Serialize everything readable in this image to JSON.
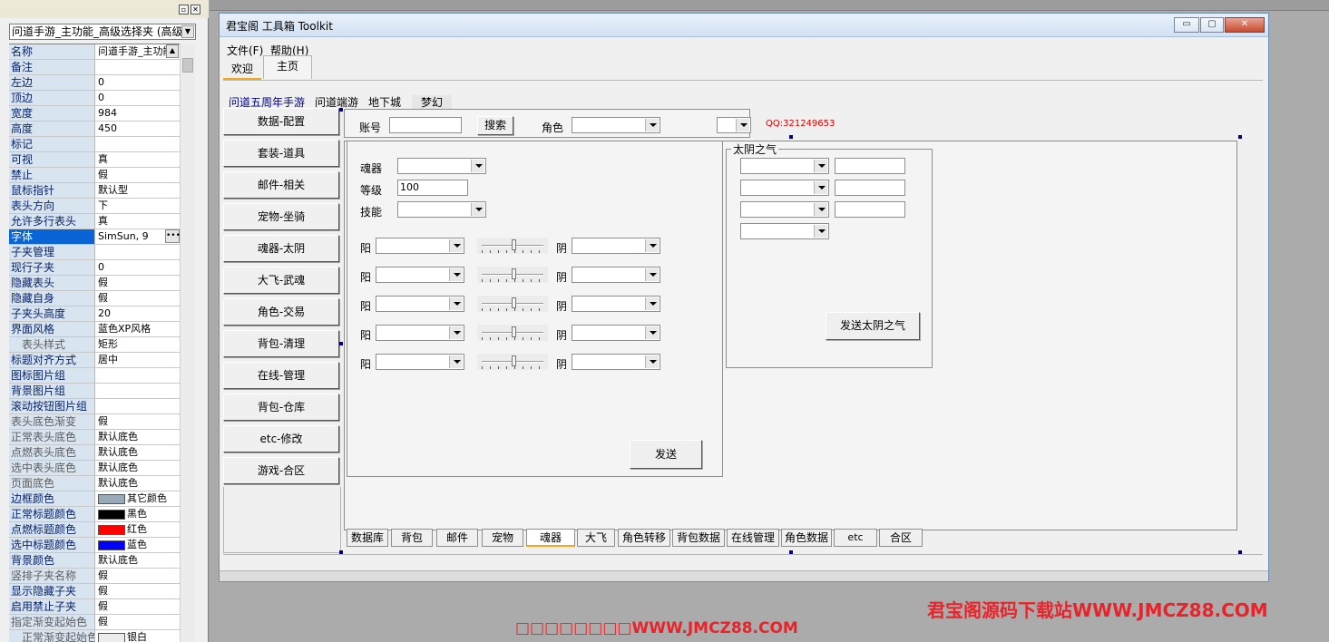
{
  "prop_panel": {
    "pin_glyph": "▫",
    "close_glyph": "✕",
    "object_selector": "问道手游_主功能_高级选择夹 (高级",
    "rows": [
      {
        "name": "名称",
        "value": "问道手游_主功能"
      },
      {
        "name": "备注",
        "value": ""
      },
      {
        "name": "左边",
        "value": "0"
      },
      {
        "name": "顶边",
        "value": "0"
      },
      {
        "name": "宽度",
        "value": "984"
      },
      {
        "name": "高度",
        "value": "450"
      },
      {
        "name": "标记",
        "value": ""
      },
      {
        "name": "可视",
        "value": "真"
      },
      {
        "name": "禁止",
        "value": "假"
      },
      {
        "name": "鼠标指针",
        "value": "默认型"
      },
      {
        "name": "表头方向",
        "value": "下"
      },
      {
        "name": "允许多行表头",
        "value": "真"
      },
      {
        "name": "字体",
        "value": "SimSun, 9"
      },
      {
        "name": "子夹管理",
        "value": ""
      },
      {
        "name": "现行子夹",
        "value": "0"
      },
      {
        "name": "隐藏表头",
        "value": "假"
      },
      {
        "name": "隐藏自身",
        "value": "假"
      },
      {
        "name": "子夹头高度",
        "value": "20"
      },
      {
        "name": "界面风格",
        "value": "蓝色XP风格"
      },
      {
        "name": "表头样式",
        "value": "矩形"
      },
      {
        "name": "标题对齐方式",
        "value": "居中"
      },
      {
        "name": "图标图片组",
        "value": ""
      },
      {
        "name": "背景图片组",
        "value": ""
      },
      {
        "name": "滚动按钮图片组",
        "value": ""
      },
      {
        "name": "表头底色渐变",
        "value": "假"
      },
      {
        "name": "正常表头底色",
        "value": "默认底色"
      },
      {
        "name": "点燃表头底色",
        "value": "默认底色"
      },
      {
        "name": "选中表头底色",
        "value": "默认底色"
      },
      {
        "name": "页面底色",
        "value": "默认底色"
      },
      {
        "name": "边框颜色",
        "value": "其它颜色"
      },
      {
        "name": "正常标题颜色",
        "value": "黑色"
      },
      {
        "name": "点燃标题颜色",
        "value": "红色"
      },
      {
        "name": "选中标题颜色",
        "value": "蓝色"
      },
      {
        "name": "背景颜色",
        "value": "默认底色"
      },
      {
        "name": "竖排子夹名称",
        "value": "假"
      },
      {
        "name": "显示隐藏子夹",
        "value": "假"
      },
      {
        "name": "启用禁止子夹",
        "value": "假"
      },
      {
        "name": "指定渐变起始色",
        "value": "假"
      },
      {
        "name": "正常渐变起始色",
        "value": "银白"
      }
    ],
    "swatch_colors": {
      "border": "#9aa9b8",
      "black": "#000000",
      "red": "#ff0000",
      "blue": "#0000ff",
      "silver": "#ececec"
    }
  },
  "window": {
    "title": "君宝阁 工具箱 Toolkit",
    "buttons": {
      "minimize": "▭",
      "maximize": "▢",
      "close": "✕"
    },
    "menu": [
      "文件(F)",
      "帮助(H)"
    ],
    "top_tabs": [
      "欢迎",
      "主页"
    ],
    "sub_tabs": [
      "问道五周年手游",
      "问道端游",
      "地下城",
      "梦幻"
    ],
    "side_buttons": [
      "数据-配置",
      "套装-道具",
      "邮件-相关",
      "宠物-坐骑",
      "魂器-太阴",
      "大飞-武魂",
      "角色-交易",
      "背包-清理",
      "在线-管理",
      "背包-仓库",
      "etc-修改",
      "游戏-合区"
    ],
    "account_bar": {
      "account_label": "账号",
      "search_button": "搜索",
      "role_label": "角色",
      "qq": "QQ:321249653"
    },
    "hunqi": {
      "soul_label": "魂器",
      "level_label": "等级",
      "level_value": "100",
      "skill_label": "技能",
      "yang_label": "阳",
      "yin_label": "阴",
      "send_button": "发送"
    },
    "taiyin": {
      "title": "太阴之气",
      "send_button": "发送太阴之气"
    },
    "bottom_tabs": [
      "数据库",
      "背包",
      "邮件",
      "宠物",
      "魂器",
      "大飞",
      "角色转移",
      "背包数据",
      "在线管理",
      "角色数据",
      "etc",
      "合区"
    ]
  },
  "watermarks": {
    "right": "君宝阁源码下载站WWW.JMCZ88.COM",
    "bottom": "□□□□□□□□WWW.JMCZ88.COM",
    "color": "#e8242a"
  }
}
